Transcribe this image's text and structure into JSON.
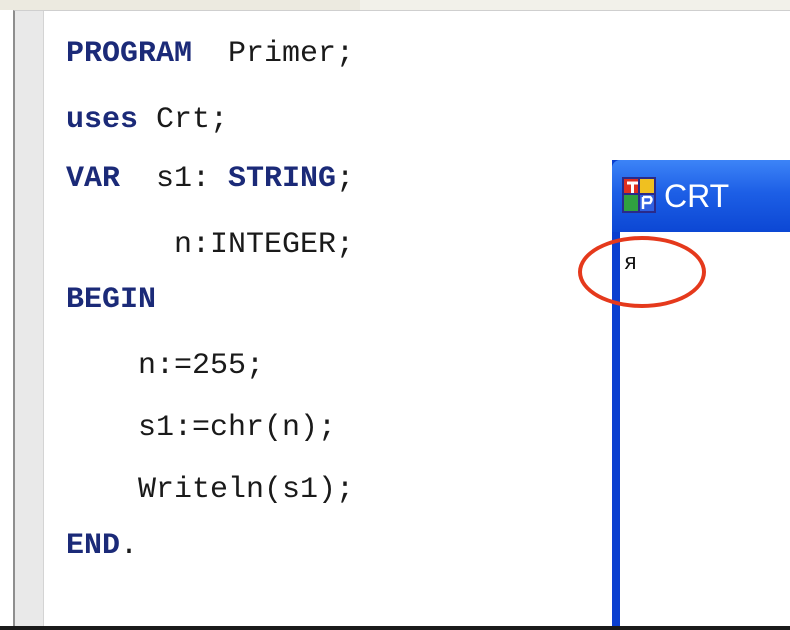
{
  "editor": {
    "lines": [
      [
        {
          "t": "PROGRAM",
          "kw": true
        },
        {
          "t": "  Primer;",
          "kw": false
        }
      ],
      [
        {
          "t": "uses",
          "kw": true
        },
        {
          "t": " Crt;",
          "kw": false
        }
      ],
      [
        {
          "t": "VAR",
          "kw": true
        },
        {
          "t": "  s1: ",
          "kw": false
        },
        {
          "t": "STRING",
          "kw": true
        },
        {
          "t": ";",
          "kw": false
        }
      ],
      [
        {
          "t": "      n:INTEGER;",
          "kw": false
        }
      ],
      [
        {
          "t": "BEGIN",
          "kw": true
        }
      ],
      [
        {
          "t": "    n:=255;",
          "kw": false
        }
      ],
      [
        {
          "t": "    s1:=chr(n);",
          "kw": false
        }
      ],
      [
        {
          "t": "    Writeln(s1);",
          "kw": false
        }
      ],
      [
        {
          "t": "END",
          "kw": true
        },
        {
          "t": ".",
          "kw": false
        }
      ]
    ]
  },
  "crt_window": {
    "title": "CRT",
    "icon": "turbo-pascal-icon",
    "output": "я"
  },
  "colors": {
    "keyword": "#1b2a78",
    "titlebar": "#1d5fe6",
    "highlight": "#e5391c"
  }
}
